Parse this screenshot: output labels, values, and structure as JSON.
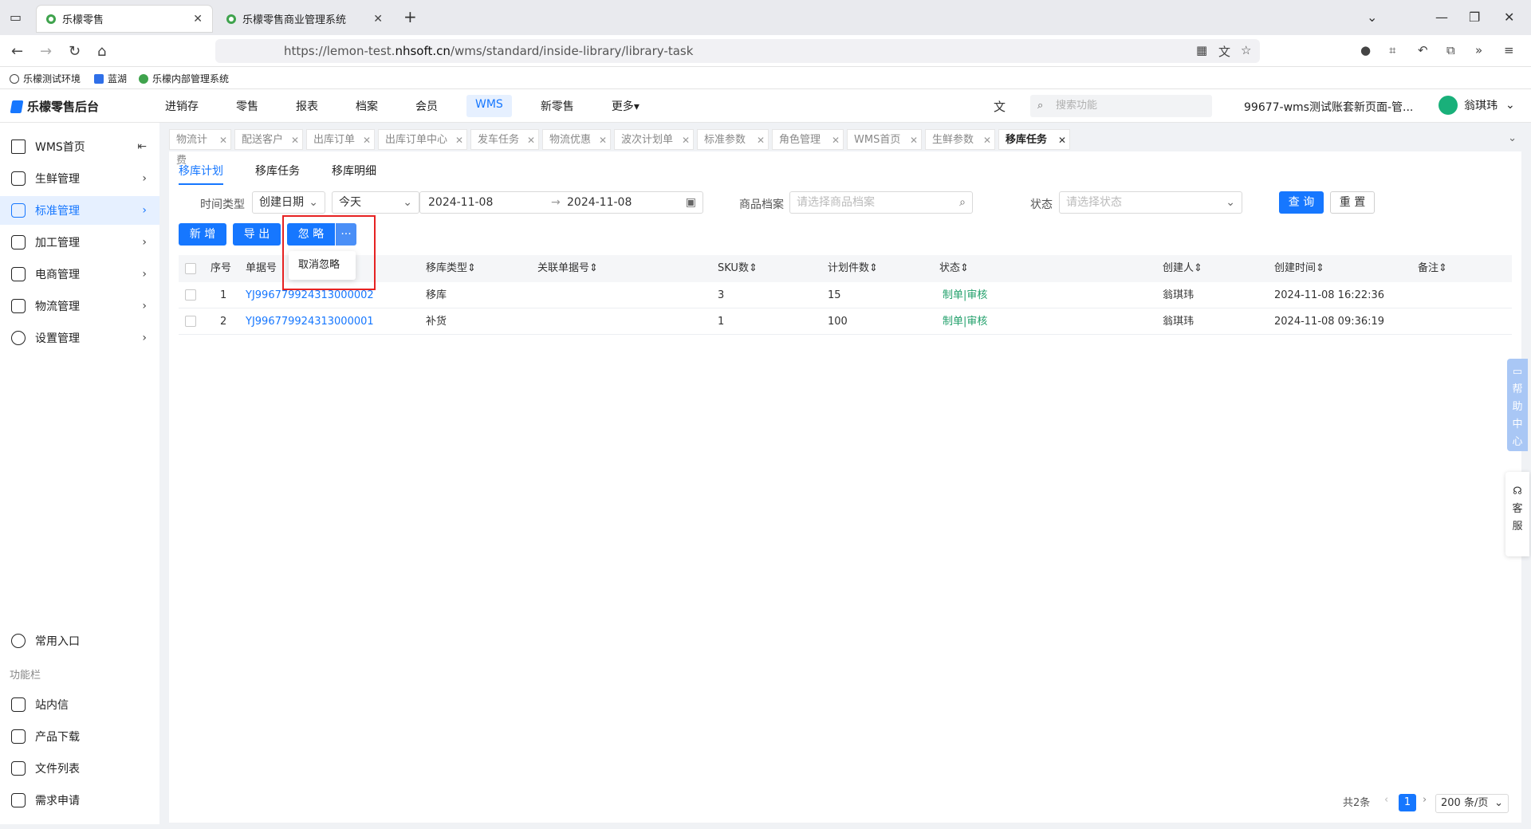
{
  "browser": {
    "tabs": [
      {
        "title": "乐檬零售"
      },
      {
        "title": "乐檬零售商业管理系统"
      }
    ],
    "url_host": "https://lemon-test.",
    "url_domain": "nhsoft.cn",
    "url_path": "/wms/standard/inside-library/library-task",
    "bookmarks": [
      "乐檬测试环境",
      "蓝湖",
      "乐檬内部管理系统"
    ]
  },
  "app": {
    "logo": "乐檬零售后台",
    "nav": [
      "进销存",
      "零售",
      "报表",
      "档案",
      "会员",
      "WMS",
      "新零售",
      "更多"
    ],
    "active_nav": "WMS",
    "search_placeholder": "搜索功能",
    "account": "99677-wms测试账套新页面-管...",
    "user": "翁琪玮"
  },
  "sidebar": {
    "items": [
      {
        "label": "WMS首页"
      },
      {
        "label": "生鲜管理"
      },
      {
        "label": "标准管理"
      },
      {
        "label": "加工管理"
      },
      {
        "label": "电商管理"
      },
      {
        "label": "物流管理"
      },
      {
        "label": "设置管理"
      }
    ],
    "common": "常用入口",
    "section": "功能栏",
    "funcs": [
      "站内信",
      "产品下载",
      "文件列表",
      "需求申请"
    ]
  },
  "tags": [
    "物流计费",
    "配送客户",
    "出库订单",
    "出库订单中心",
    "发车任务",
    "物流优惠",
    "波次计划单",
    "标准参数",
    "角色管理",
    "WMS首页",
    "生鲜参数",
    "移库任务"
  ],
  "subtabs": [
    "移库计划",
    "移库任务",
    "移库明细"
  ],
  "filters": {
    "time_type_label": "时间类型",
    "time_type_value": "创建日期",
    "period_value": "今天",
    "date_start": "2024-11-08",
    "date_end": "2024-11-08",
    "goods_label": "商品档案",
    "goods_placeholder": "请选择商品档案",
    "status_label": "状态",
    "status_placeholder": "请选择状态",
    "query": "查 询",
    "reset": "重 置"
  },
  "actions": {
    "add": "新 增",
    "export": "导 出",
    "ignore": "忽 略",
    "more": "···",
    "dropdown_item": "取消忽略"
  },
  "table": {
    "headers": [
      "序号",
      "单据号",
      "移库类型",
      "关联单据号",
      "SKU数",
      "计划件数",
      "状态",
      "创建人",
      "创建时间",
      "备注"
    ],
    "rows": [
      {
        "no": "1",
        "doc": "YJ996779924313000002",
        "type": "移库",
        "related": "",
        "sku": "3",
        "qty": "15",
        "status": "制单|审核",
        "creator": "翁琪玮",
        "time": "2024-11-08 16:22:36",
        "note": ""
      },
      {
        "no": "2",
        "doc": "YJ996779924313000001",
        "type": "补货",
        "related": "",
        "sku": "1",
        "qty": "100",
        "status": "制单|审核",
        "creator": "翁琪玮",
        "time": "2024-11-08 09:36:19",
        "note": ""
      }
    ]
  },
  "float": {
    "help": "帮助中心",
    "service": "客服"
  },
  "pagination": {
    "total": "共2条",
    "current": "1",
    "size": "200 条/页"
  }
}
